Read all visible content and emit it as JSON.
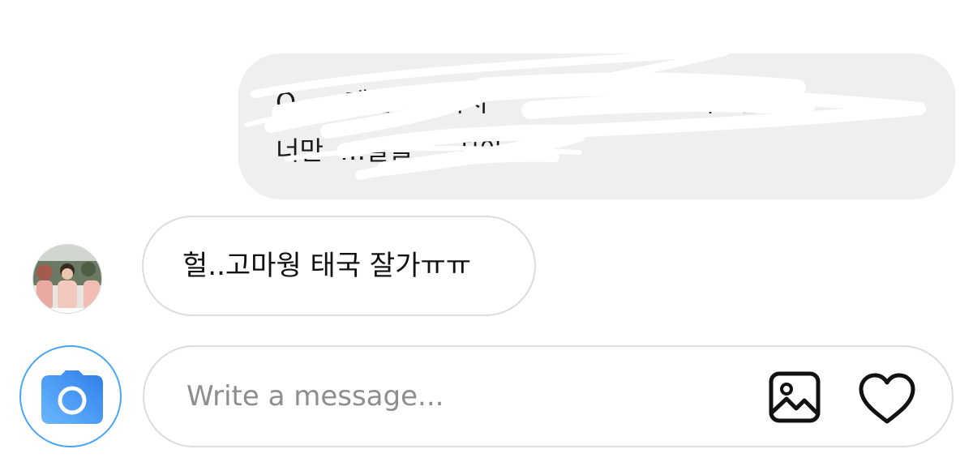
{
  "conversation": {
    "sent_message": {
      "line1_visible": [
        "Q",
        "…제안해주셔서",
        "지그는"
      ],
      "line2_visible": [
        "너만",
        "…말을",
        "…지아"
      ],
      "heart": "❤"
    },
    "received_message": {
      "text": "헐..고마웡 태국 잘가ㅠㅠ"
    }
  },
  "composer": {
    "placeholder": "Write a message...",
    "value": ""
  },
  "icons": {
    "camera": "camera-icon",
    "gallery": "image-gallery-icon",
    "like": "heart-icon"
  },
  "colors": {
    "sent_bubble_bg": "#efefef",
    "received_border": "#dcdcdc",
    "camera_gradient_start": "#5aa9ff",
    "camera_gradient_end": "#2f7de8",
    "placeholder": "#8e8e8e"
  }
}
